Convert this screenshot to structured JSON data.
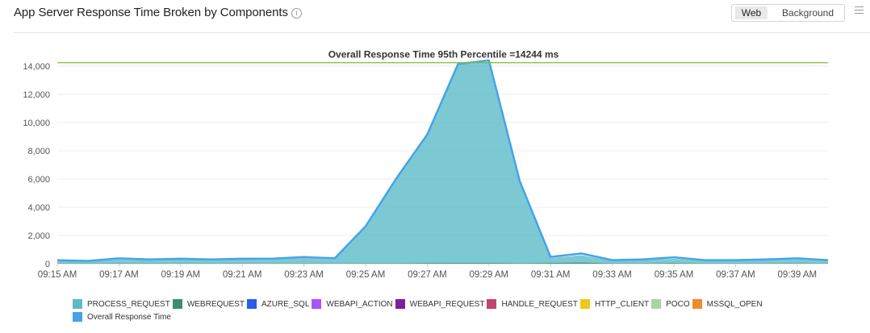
{
  "header": {
    "title": "App Server Response Time Broken by Components",
    "info_icon": "info-icon",
    "toggle": {
      "web": "Web",
      "background": "Background",
      "selected": "Web"
    },
    "menu_icon": "hamburger-menu-icon"
  },
  "chart_data": {
    "type": "area",
    "annotation": "Overall Response Time 95th Percentile =14244 ms",
    "threshold": 14244,
    "threshold_color": "#7cbf29",
    "ylim": [
      0,
      14000
    ],
    "yticks": [
      "0",
      "2,000",
      "4,000",
      "6,000",
      "8,000",
      "10,000",
      "12,000",
      "14,000"
    ],
    "xticks": [
      "09:15 AM",
      "09:17 AM",
      "09:19 AM",
      "09:21 AM",
      "09:23 AM",
      "09:25 AM",
      "09:27 AM",
      "09:29 AM",
      "09:31 AM",
      "09:33 AM",
      "09:35 AM",
      "09:37 AM",
      "09:39 AM"
    ],
    "x": [
      "09:15 AM",
      "09:16 AM",
      "09:17 AM",
      "09:18 AM",
      "09:19 AM",
      "09:20 AM",
      "09:21 AM",
      "09:22 AM",
      "09:23 AM",
      "09:24 AM",
      "09:25 AM",
      "09:26 AM",
      "09:27 AM",
      "09:28 AM",
      "09:29 AM",
      "09:30 AM",
      "09:31 AM",
      "09:32 AM",
      "09:33 AM",
      "09:34 AM",
      "09:35 AM",
      "09:36 AM",
      "09:37 AM",
      "09:38 AM",
      "09:39 AM",
      "09:40 AM"
    ],
    "series": [
      {
        "name": "PROCESS_REQUEST",
        "color": "#5bbcc9",
        "values": [
          200,
          150,
          300,
          250,
          300,
          250,
          300,
          300,
          400,
          300,
          2600,
          6000,
          9100,
          14100,
          14300,
          5800,
          400,
          600,
          200,
          250,
          350,
          200,
          200,
          250,
          300,
          200
        ]
      },
      {
        "name": "WEBREQUEST",
        "color": "#3a8f71",
        "values": [
          20,
          20,
          30,
          20,
          20,
          20,
          20,
          20,
          20,
          20,
          30,
          30,
          40,
          50,
          50,
          30,
          50,
          80,
          20,
          20,
          40,
          20,
          20,
          20,
          30,
          20
        ]
      },
      {
        "name": "AZURE_SQL",
        "color": "#2a5ee8",
        "values": []
      },
      {
        "name": "WEBAPI_ACTION",
        "color": "#a855f7",
        "values": []
      },
      {
        "name": "WEBAPI_REQUEST",
        "color": "#7e1fa3",
        "values": []
      },
      {
        "name": "HANDLE_REQUEST",
        "color": "#c2456b",
        "values": []
      },
      {
        "name": "HTTP_CLIENT",
        "color": "#eacb19",
        "values": []
      },
      {
        "name": "POCO",
        "color": "#a9d3a6",
        "values": []
      },
      {
        "name": "MSSQL_OPEN",
        "color": "#f08a2e",
        "values": []
      },
      {
        "name": "Overall Response Time",
        "color": "#45a3ea",
        "values": [
          240,
          190,
          380,
          300,
          350,
          300,
          350,
          360,
          470,
          380,
          2650,
          6050,
          9150,
          14150,
          14400,
          5850,
          480,
          720,
          250,
          300,
          450,
          250,
          250,
          300,
          380,
          250
        ]
      }
    ]
  }
}
